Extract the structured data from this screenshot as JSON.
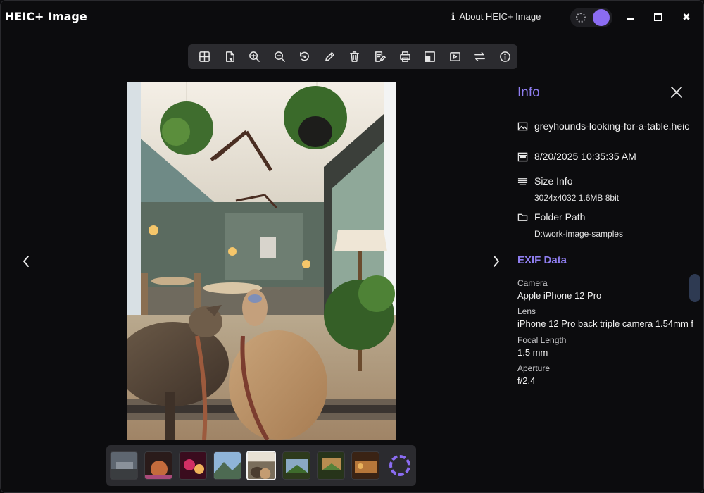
{
  "app": {
    "title": "HEIC+ Image",
    "about_label": "About HEIC+ Image"
  },
  "toolbar": {
    "tools": [
      "grid-view",
      "open-file",
      "zoom-in",
      "zoom-out",
      "rotate",
      "edit",
      "delete",
      "save-as",
      "print",
      "crop",
      "slideshow",
      "convert",
      "info"
    ]
  },
  "photo": {
    "description_icon": "image-icon"
  },
  "filmstrip": {
    "count": 9,
    "selected_index": 4
  },
  "info": {
    "title": "Info",
    "filename": "greyhounds-looking-for-a-table.heic",
    "datetime": "8/20/2025 10:35:35 AM",
    "size_label": "Size Info",
    "size_value": "3024x4032  1.6MB  8bit",
    "folder_label": "Folder Path",
    "folder_value": "D:\\work-image-samples",
    "exif_title": "EXIF Data",
    "exif": [
      {
        "key": "Camera",
        "value": "Apple iPhone 12 Pro"
      },
      {
        "key": "Lens",
        "value": "iPhone 12 Pro back triple camera 1.54mm f"
      },
      {
        "key": "Focal Length",
        "value": "1.5 mm"
      },
      {
        "key": "Aperture",
        "value": "f/2.4"
      }
    ]
  },
  "colors": {
    "accent": "#8f7ef0",
    "toggle_knob": "#8b6cf2",
    "toolbar_bg": "#2b2b2f",
    "background": "#0c0c0e"
  }
}
